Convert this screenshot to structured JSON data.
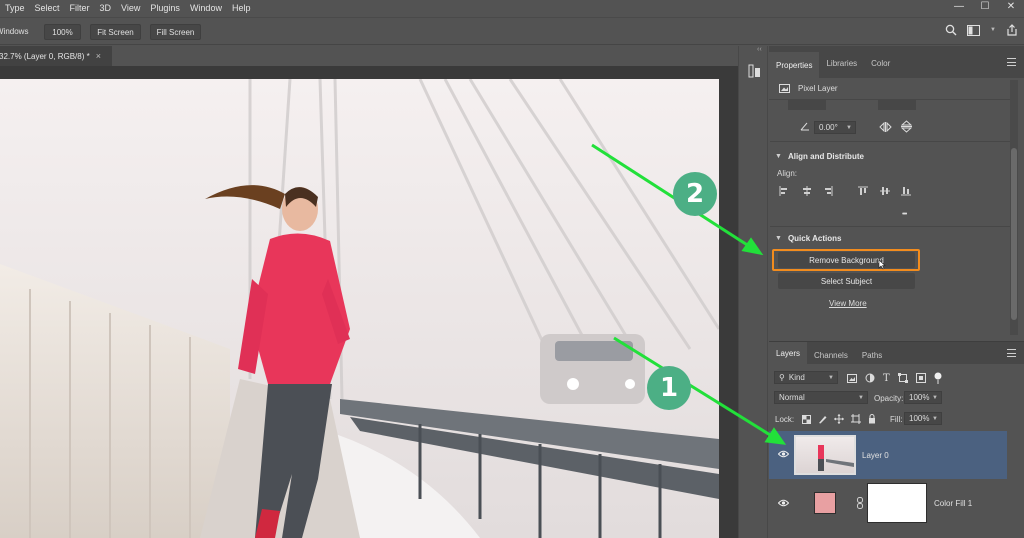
{
  "menu": [
    "Type",
    "Select",
    "Filter",
    "3D",
    "View",
    "Plugins",
    "Window",
    "Help"
  ],
  "window_controls": [
    "minimize-icon",
    "maximize-icon",
    "close-icon"
  ],
  "options_bar": {
    "windows_label": "Windows",
    "zoom_value": "100%",
    "fit_screen": "Fit Screen",
    "fill_screen": "Fill Screen"
  },
  "document": {
    "tab_title": "32.7% (Layer 0, RGB/8) *",
    "close_glyph": "×"
  },
  "properties": {
    "tabs": [
      "Properties",
      "Libraries",
      "Color"
    ],
    "layer_type": "Pixel Layer",
    "angle_value": "0.00°",
    "align_section": "Align and Distribute",
    "align_label": "Align:",
    "more_glyph": "•••",
    "quick_actions_section": "Quick Actions",
    "remove_background": "Remove Background",
    "select_subject": "Select Subject",
    "view_more": "View More"
  },
  "layers_panel": {
    "tabs": [
      "Layers",
      "Channels",
      "Paths"
    ],
    "filter_kind": "Kind",
    "blend_mode": "Normal",
    "opacity_label": "Opacity:",
    "opacity_value": "100%",
    "lock_label": "Lock:",
    "fill_label": "Fill:",
    "fill_value": "100%",
    "layers": [
      {
        "name": "Layer 0",
        "selected": true
      },
      {
        "name": "Color Fill 1",
        "selected": false
      }
    ]
  },
  "annotations": {
    "marker_1": "1",
    "marker_2": "2",
    "highlight_color": "#f28c1e",
    "arrow_color": "#22e03a",
    "marker_color": "#4caf85"
  }
}
